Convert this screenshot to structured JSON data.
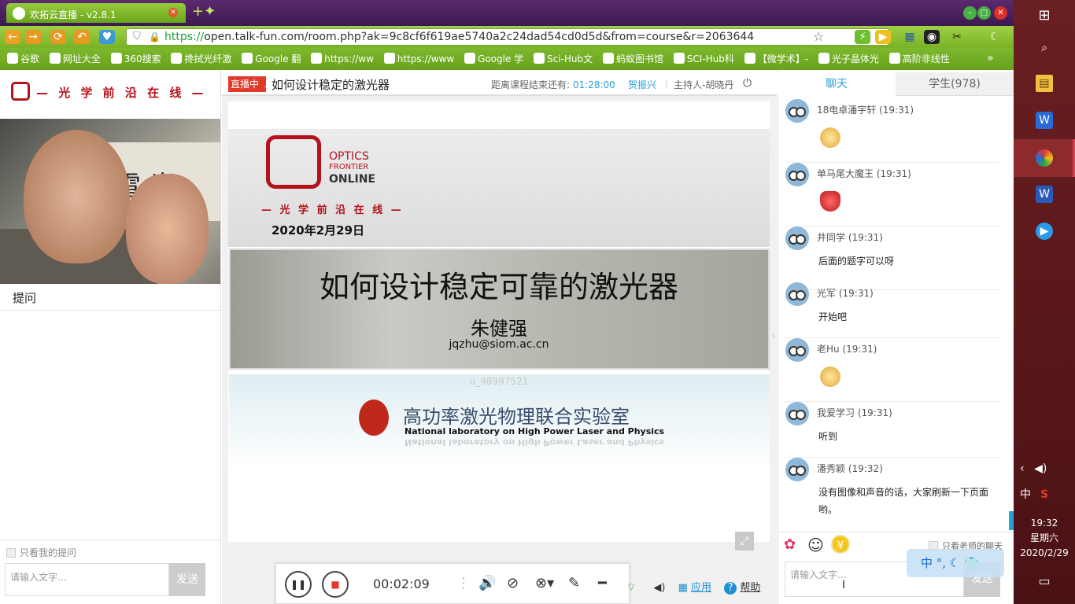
{
  "browser": {
    "tab_title": "欢拓云直播 - v2.8.1",
    "url_proto": "https://",
    "url_rest": "open.talk-fun.com/room.php?ak=9c8cf6f619ae5740a2c24dad54cd0d5d&from=course&r=2063644",
    "bookmarks": [
      "谷歌",
      "网址大全",
      "360搜索",
      "搀拭光纤激",
      "Google 翻",
      "https://ww",
      "https://www",
      "Google 学",
      "Sci-Hub文",
      "蚂蚁图书馆",
      "SCI-Hub科",
      "【微学术】-",
      "光子晶体光",
      "高阶非线性"
    ],
    "more": "»"
  },
  "left": {
    "logo_text": "— 光 学 前 沿 在 线 —",
    "scroll_char": "電 光",
    "ask_title": "提问",
    "mine_only": "只看我的提问",
    "input_placeholder": "请输入文字...",
    "send": "发送"
  },
  "room": {
    "live_badge": "直播中",
    "course_title": "如何设计稳定的激光器",
    "remain_label": "距离课程结束还有:",
    "remain_time": "01:28:00",
    "praise": "贺振兴",
    "divider": "|",
    "host": "主持人-胡晓丹"
  },
  "slide": {
    "optics": "OPTICS",
    "frontier": "FRONTIER",
    "online": "ONLINE",
    "cn_brand": "— 光 学 前 沿 在 线 —",
    "date": "2020年2月29日",
    "title": "如何设计稳定可靠的激光器",
    "author": "朱健强",
    "email": "jqzhu@siom.ac.cn",
    "uid": "u_98997521",
    "lab_cn": "高功率激光物理联合实验室",
    "lab_en": "National laboratory on High Power Laser and Physics"
  },
  "player": {
    "time": "00:02:09",
    "apps": "应用",
    "help": "帮助"
  },
  "chat": {
    "tab_chat": "聊天",
    "tab_students": "学生(978)",
    "messages": [
      {
        "name": "18电卓潘宇轩",
        "time": "(19:31)",
        "text": "",
        "emoji": "smile"
      },
      {
        "name": "单马尾大魔王",
        "time": "(19:31)",
        "text": "",
        "emoji": "flower"
      },
      {
        "name": "井同学",
        "time": "(19:31)",
        "text": "后面的题字可以呀"
      },
      {
        "name": "光军",
        "time": "(19:31)",
        "text": "开始吧"
      },
      {
        "name": "老Hu",
        "time": "(19:31)",
        "text": "",
        "emoji": "smile"
      },
      {
        "name": "我爱学习",
        "time": "(19:31)",
        "text": "听到"
      },
      {
        "name": "潘秀颖",
        "time": "(19:32)",
        "text": "没有图像和声音的话，大家刷新一下页面哟。"
      }
    ],
    "teacher_only": "只看老师的聊天",
    "input_placeholder": "请输入文字...",
    "send": "发送",
    "ime": "中 °, ☾ 👕"
  },
  "taskbar": {
    "tray_ime": "中",
    "time": "19:32",
    "weekday": "星期六",
    "date": "2020/2/29"
  }
}
